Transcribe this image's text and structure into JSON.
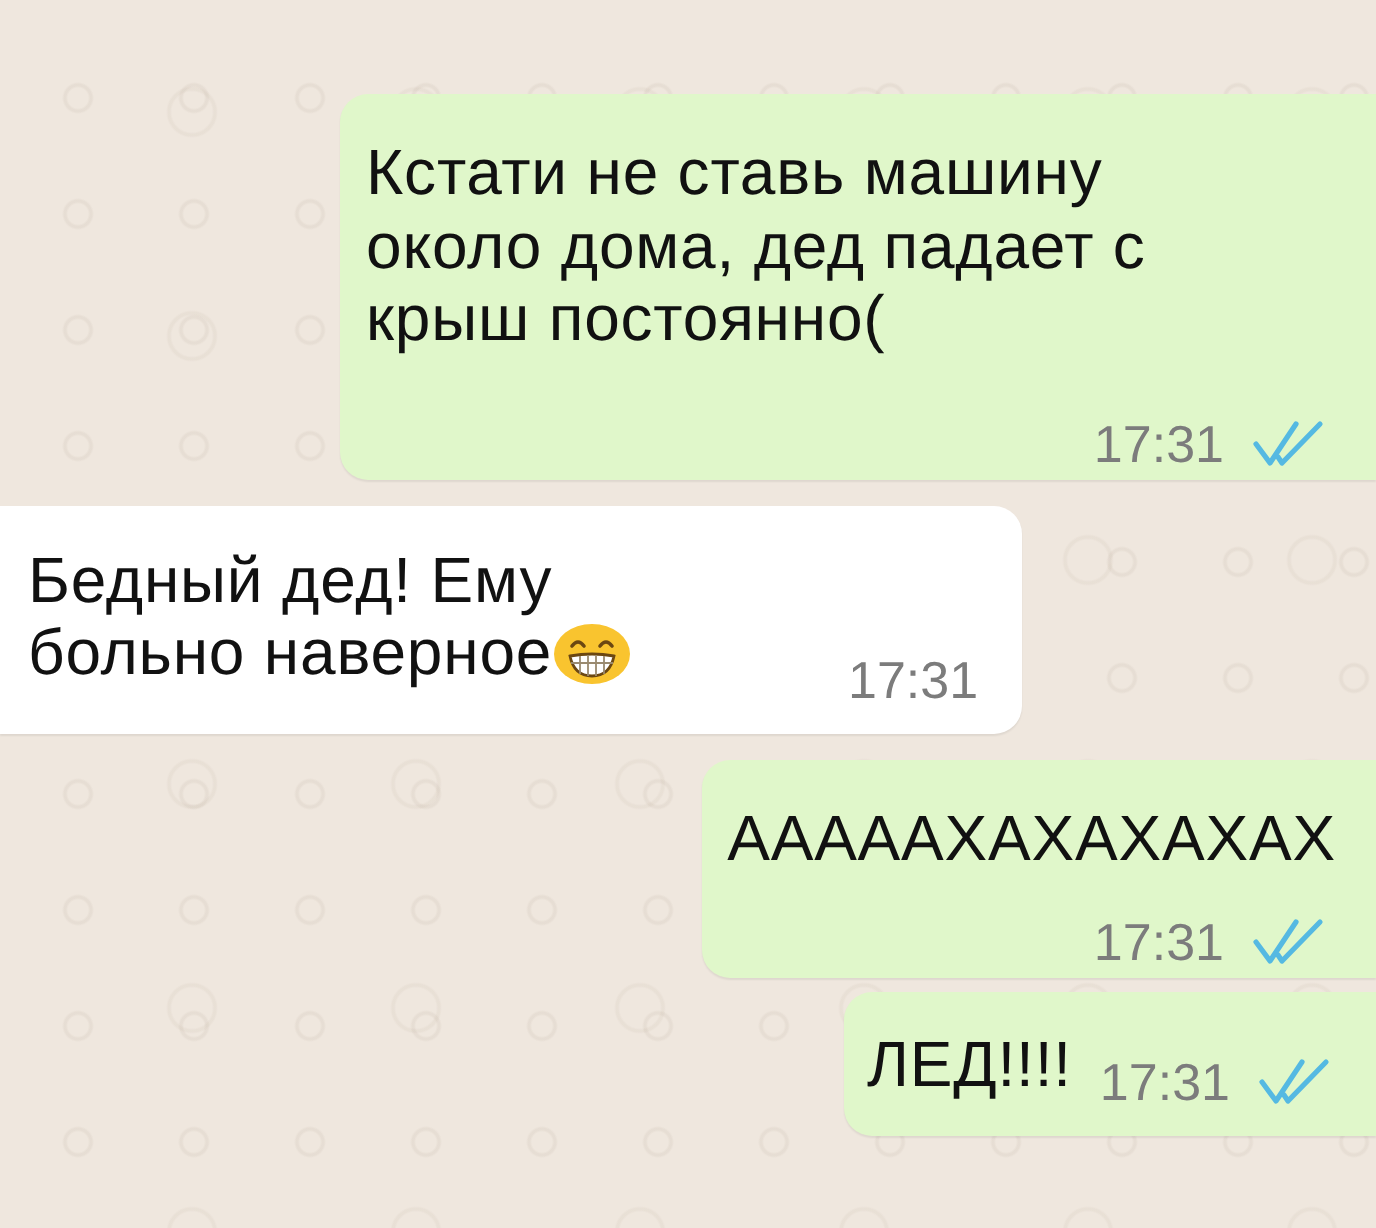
{
  "messages": [
    {
      "kind": "outgoing",
      "text": "Кстати не ставь машину около дома, дед падает с крыш постоянно(",
      "emoji": false,
      "time": "17:31",
      "read": true
    },
    {
      "kind": "incoming",
      "text": "Бедный дед! Ему больно наверное",
      "emoji": true,
      "time": "17:31"
    },
    {
      "kind": "outgoing",
      "text": "АААААХАХАХАХАХ",
      "emoji": false,
      "time": "17:31",
      "read": true
    },
    {
      "kind": "outgoing",
      "text": "ЛЕД!!!!",
      "emoji": false,
      "time": "17:31",
      "read": true
    }
  ]
}
